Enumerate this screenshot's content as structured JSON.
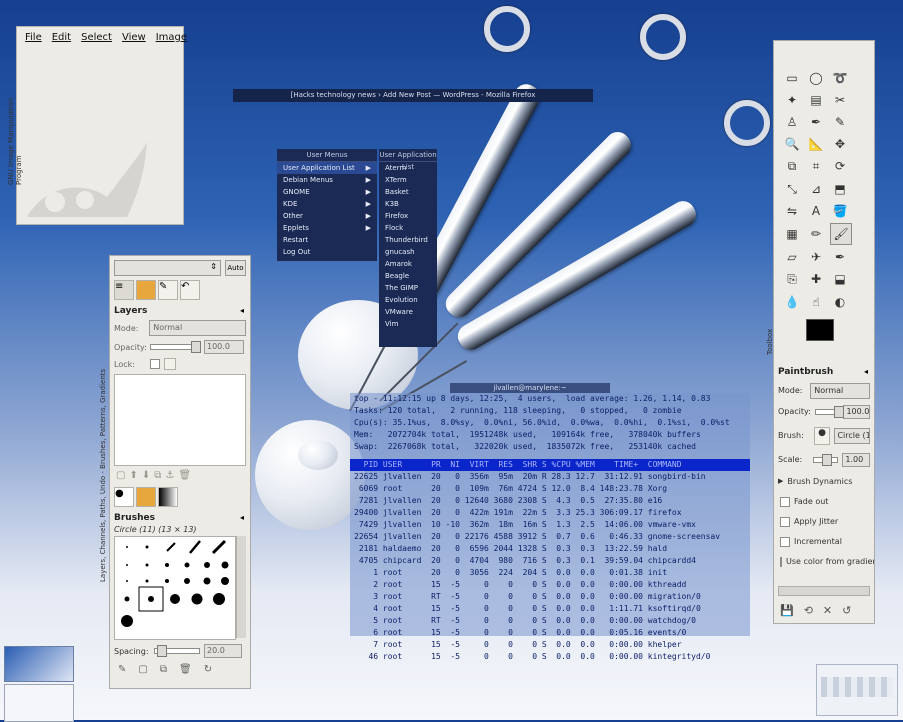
{
  "image_window": {
    "menu": [
      "File",
      "Edit",
      "Select",
      "View",
      "Image"
    ],
    "side_title": "GNU Image Manipulation Program"
  },
  "firefox_title": "[Hacks technology news › Add New Post — WordPress - Mozilla Firefox",
  "user_menus": {
    "title": "User Menus",
    "items": [
      "User Application List",
      "Debian Menus",
      "GNOME",
      "KDE",
      "Other",
      "Epplets",
      "Restart",
      "Log Out"
    ],
    "submenu_flags": [
      true,
      true,
      true,
      true,
      true,
      true,
      false,
      false
    ]
  },
  "app_list": {
    "title": "User Application List",
    "items": [
      "Aterm",
      "XTerm",
      "Basket",
      "K3B",
      "Firefox",
      "Flock",
      "Thunderbird",
      "gnucash",
      "Amarok",
      "Beagle",
      "The GIMP",
      "Evolution",
      "VMware",
      "Vim"
    ]
  },
  "terminal": {
    "title": "jlvallen@marylene:~",
    "summary": [
      "top - 11:12:15 up 8 days, 12:25,  4 users,  load average: 1.26, 1.14, 0.83",
      "Tasks: 120 total,   2 running, 118 sleeping,   0 stopped,   0 zombie",
      "Cpu(s): 35.1%us,  8.0%sy,  0.0%ni, 56.0%id,  0.0%wa,  0.0%hi,  0.1%si,  0.0%st",
      "Mem:   2072704k total,  1951248k used,   109164k free,   378040k buffers",
      "Swap:  2267068k total,   322020k used,  1835072k free,   253140k cached"
    ],
    "header": "  PID USER      PR  NI  VIRT  RES  SHR S %CPU %MEM    TIME+  COMMAND",
    "rows": [
      "22625 jlvallen  20   0  356m  95m  20m R 28.3 12.7  31:12.91 songbird-bin",
      " 6069 root      20   0  109m  76m 4724 S 12.0  8.4 148:23.78 Xorg",
      " 7281 jlvallen  20   0 12640 3680 2308 S  4.3  0.5  27:35.80 e16",
      "29400 jlvallen  20   0  422m 191m  22m S  3.3 25.3 306:09.17 firefox",
      " 7429 jlvallen  10 -10  362m  18m  16m S  1.3  2.5  14:06.00 vmware-vmx",
      "22654 jlvallen  20   0 22176 4588 3912 S  0.7  0.6   0:46.33 gnome-screensav",
      " 2181 haldaemo  20   0  6596 2044 1328 S  0.3  0.3  13:22.59 hald",
      " 4705 chipcard  20   0  4704  980  716 S  0.3  0.1  39:59.04 chipcardd4",
      "    1 root      20   0  3056  224  204 S  0.0  0.0   0:01.38 init",
      "    2 root      15  -5     0    0    0 S  0.0  0.0   0:00.00 kthreadd",
      "    3 root      RT  -5     0    0    0 S  0.0  0.0   0:00.00 migration/0",
      "    4 root      15  -5     0    0    0 S  0.0  0.0   1:11.71 ksoftirqd/0",
      "    5 root      RT  -5     0    0    0 S  0.0  0.0   0:00.00 watchdog/0",
      "    6 root      15  -5     0    0    0 S  0.0  0.0   0:05.16 events/0",
      "    7 root      15  -5     0    0    0 S  0.0  0.0   0:00.00 khelper",
      "   46 root      15  -5     0    0    0 S  0.0  0.0   0:00.00 kintegrityd/0"
    ]
  },
  "layers_dock": {
    "auto_label": "Auto",
    "layers_title": "Layers",
    "mode_label": "Mode:",
    "mode_value": "Normal",
    "opacity_label": "Opacity:",
    "opacity_value": "100.0",
    "lock_label": "Lock:",
    "side_tabs": "Layers, Channels, Paths, Undo - Brushes, Patterns, Gradients",
    "brushes_title": "Brushes",
    "brush_name": "Circle (11) (13 × 13)",
    "spacing_label": "Spacing:",
    "spacing_value": "20.0"
  },
  "toolbox": {
    "side_title": "Toolbox",
    "tool_icons": [
      "rect-select",
      "ellipse-select",
      "free-select",
      "fuzzy-select",
      "color-select",
      "scissors",
      "foreground-select",
      "paths",
      "color-picker",
      "zoom",
      "measure",
      "move",
      "align",
      "crop",
      "rotate",
      "scale",
      "shear",
      "perspective",
      "flip",
      "text",
      "bucket-fill",
      "blend",
      "pencil",
      "paintbrush",
      "eraser",
      "airbrush",
      "ink",
      "clone",
      "heal",
      "perspective-clone",
      "convolve",
      "smudge",
      "dodge-burn"
    ],
    "selected_tool": "paintbrush",
    "options_title": "Paintbrush",
    "mode_label": "Mode:",
    "mode_value": "Normal",
    "opacity_label": "Opacity:",
    "opacity_value": "100.0",
    "brush_label": "Brush:",
    "brush_value": "Circle (11)",
    "scale_label": "Scale:",
    "scale_value": "1.00",
    "dynamics_label": "Brush Dynamics",
    "checkboxes": [
      "Fade out",
      "Apply Jitter",
      "Incremental",
      "Use color from gradient"
    ]
  }
}
